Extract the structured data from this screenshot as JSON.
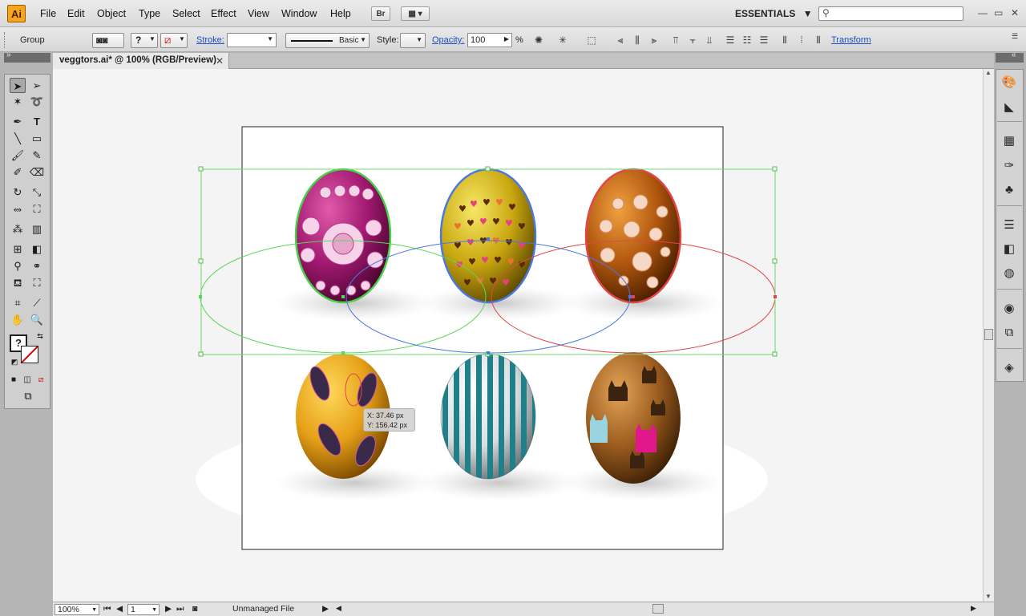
{
  "app": {
    "logo": "Ai",
    "menu": [
      "File",
      "Edit",
      "Object",
      "Type",
      "Select",
      "Effect",
      "View",
      "Window",
      "Help"
    ],
    "bridge_label": "Br",
    "workspace": "ESSENTIALS",
    "search_placeholder": ""
  },
  "control_bar": {
    "selection_type": "Group",
    "fill_label": "?",
    "stroke_label": "Stroke:",
    "brush_label": "Basic",
    "style_label": "Style:",
    "opacity_label": "Opacity:",
    "opacity_value": "100",
    "opacity_unit": "%",
    "transform_label": "Transform"
  },
  "document": {
    "tab_title": "veggtors.ai* @ 100% (RGB/Preview)",
    "close_glyph": "✕"
  },
  "tooltip": {
    "x": "X: 37.46 px",
    "y": "Y: 156.42 px"
  },
  "status": {
    "zoom": "100%",
    "page": "1",
    "file_state": "Unmanaged File"
  },
  "eggs": [
    {
      "name": "pink-flower-egg",
      "base": "#a01870",
      "pattern": "flowers"
    },
    {
      "name": "gold-hearts-egg",
      "base": "#c9a810",
      "pattern": "hearts"
    },
    {
      "name": "brown-flower-egg",
      "base": "#b0560e",
      "pattern": "flowers-small"
    },
    {
      "name": "orange-floral-egg",
      "base": "#e6a017",
      "pattern": "floral"
    },
    {
      "name": "teal-stripe-egg",
      "base": "#1f7f8a",
      "pattern": "stripes"
    },
    {
      "name": "cat-egg",
      "base": "#9c5d1f",
      "pattern": "cats"
    }
  ],
  "colors": {
    "selection_box": "#6ad86a",
    "green_path": "#5bd65b",
    "blue_path": "#4a78e0",
    "red_path": "#e04848"
  }
}
